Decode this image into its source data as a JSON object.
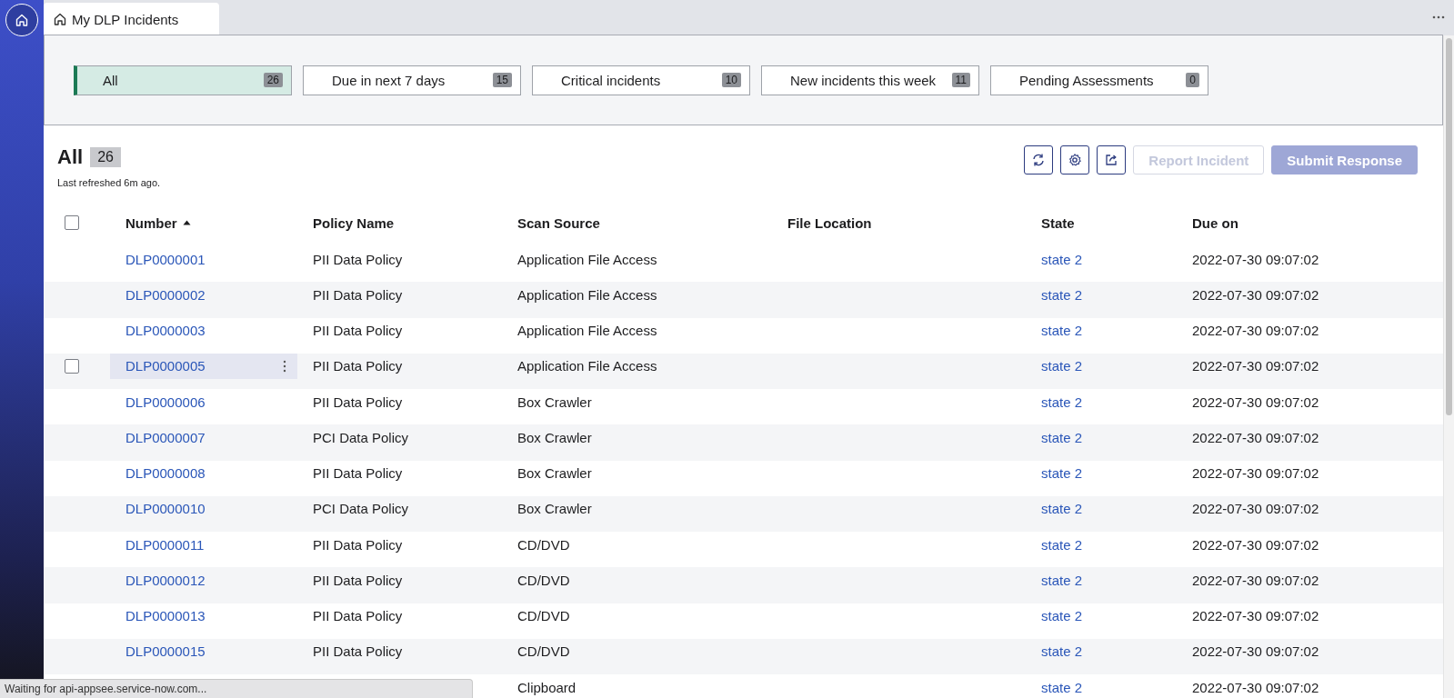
{
  "tab": {
    "label": "My DLP Incidents"
  },
  "filters": [
    {
      "label": "All",
      "count": "26",
      "selected": true
    },
    {
      "label": "Due in next 7 days",
      "count": "15",
      "selected": false
    },
    {
      "label": "Critical incidents",
      "count": "10",
      "selected": false
    },
    {
      "label": "New incidents this week",
      "count": "11",
      "selected": false
    },
    {
      "label": "Pending Assessments",
      "count": "0",
      "selected": false
    }
  ],
  "list": {
    "title": "All",
    "count": "26",
    "refreshed": "Last refreshed 6m ago."
  },
  "actions": [
    {
      "label": "Report Incident",
      "kind": "outline",
      "disabled": true
    },
    {
      "label": "Submit Response",
      "kind": "primary",
      "disabled": true
    }
  ],
  "table": {
    "select_all": {
      "checked": false
    },
    "columns": [
      "Number",
      "Policy Name",
      "Scan Source",
      "File Location",
      "State",
      "Due on"
    ],
    "rows": [
      {
        "number": "DLP0000001",
        "policy": "PII Data Policy",
        "source": "Application File Access",
        "state": "state 2",
        "due": "2022-07-30 09:07:02",
        "hovered": false
      },
      {
        "number": "DLP0000002",
        "policy": "PII Data Policy",
        "source": "Application File Access",
        "state": "state 2",
        "due": "2022-07-30 09:07:02",
        "hovered": false
      },
      {
        "number": "DLP0000003",
        "policy": "PII Data Policy",
        "source": "Application File Access",
        "state": "state 2",
        "due": "2022-07-30 09:07:02",
        "hovered": false
      },
      {
        "number": "DLP0000005",
        "policy": "PII Data Policy",
        "source": "Application File Access",
        "state": "state 2",
        "due": "2022-07-30 09:07:02",
        "hovered": true
      },
      {
        "number": "DLP0000006",
        "policy": "PII Data Policy",
        "source": "Box Crawler",
        "state": "state 2",
        "due": "2022-07-30 09:07:02",
        "hovered": false
      },
      {
        "number": "DLP0000007",
        "policy": "PCI Data Policy",
        "source": "Box Crawler",
        "state": "state 2",
        "due": "2022-07-30 09:07:02",
        "hovered": false
      },
      {
        "number": "DLP0000008",
        "policy": "PII Data Policy",
        "source": "Box Crawler",
        "state": "state 2",
        "due": "2022-07-30 09:07:02",
        "hovered": false
      },
      {
        "number": "DLP0000010",
        "policy": "PCI Data Policy",
        "source": "Box Crawler",
        "state": "state 2",
        "due": "2022-07-30 09:07:02",
        "hovered": false
      },
      {
        "number": "DLP0000011",
        "policy": "PII Data Policy",
        "source": "CD/DVD",
        "state": "state 2",
        "due": "2022-07-30 09:07:02",
        "hovered": false
      },
      {
        "number": "DLP0000012",
        "policy": "PII Data Policy",
        "source": "CD/DVD",
        "state": "state 2",
        "due": "2022-07-30 09:07:02",
        "hovered": false
      },
      {
        "number": "DLP0000013",
        "policy": "PII Data Policy",
        "source": "CD/DVD",
        "state": "state 2",
        "due": "2022-07-30 09:07:02",
        "hovered": false
      },
      {
        "number": "DLP0000015",
        "policy": "PII Data Policy",
        "source": "CD/DVD",
        "state": "state 2",
        "due": "2022-07-30 09:07:02",
        "hovered": false
      },
      {
        "source": "Clipboard",
        "state": "state 2",
        "due": "2022-07-30 09:07:02"
      }
    ]
  },
  "status_bar": "Waiting for api-appsee.service-now.com..."
}
